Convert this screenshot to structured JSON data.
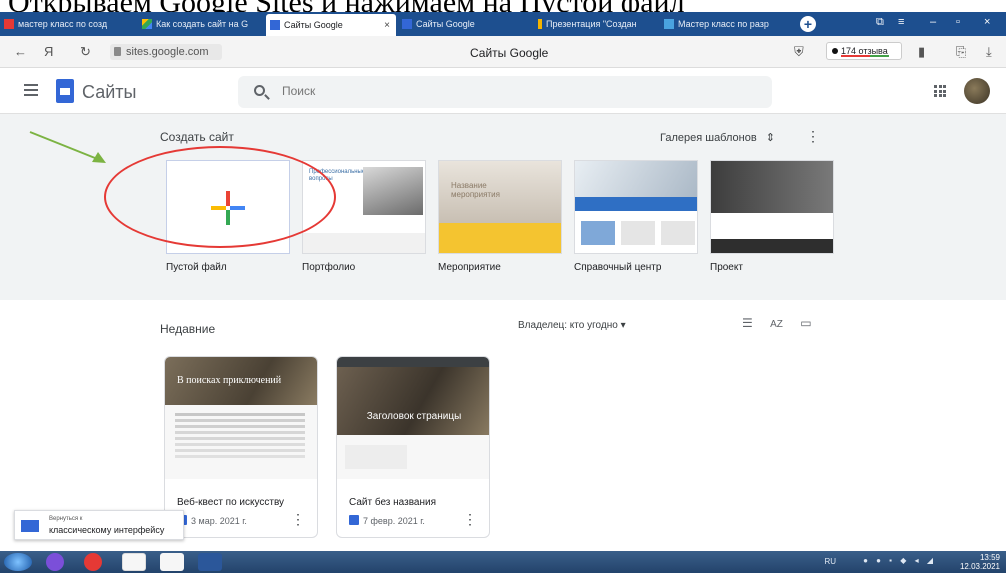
{
  "caption": "Открываем Google Sites и нажимаем на Пустой файл",
  "browser": {
    "tabs": [
      {
        "label": "мастер класс по созд",
        "icon": "yandex-icon",
        "active": false
      },
      {
        "label": "Как создать сайт на G",
        "icon": "drive-icon",
        "active": false
      },
      {
        "label": "Сайты Google",
        "icon": "sites-icon",
        "active": true
      },
      {
        "label": "Сайты Google",
        "icon": "sites-icon",
        "active": false
      },
      {
        "label": "Презентация \"Создан",
        "icon": "slides-icon",
        "active": false
      },
      {
        "label": "Мастер класс по разр",
        "icon": "blog-icon",
        "active": false
      }
    ],
    "tab_close": "×",
    "new_tab": "+",
    "url": "sites.google.com",
    "page_title": "Сайты Google",
    "reviews": "174 отзыва",
    "nav_back": "←",
    "nav_yandex": "Я",
    "nav_reload": "↻"
  },
  "app": {
    "name": "Сайты",
    "search_placeholder": "Поиск"
  },
  "create": {
    "title": "Создать сайт",
    "gallery": "Галерея шаблонов",
    "gallery_arrow": "⇕",
    "more": "⋮",
    "templates": [
      {
        "label": "Пустой файл"
      },
      {
        "label": "Портфолио",
        "thumb_text": "Профессиональные вопросы"
      },
      {
        "label": "Мероприятие",
        "thumb_text": "Название мероприятия"
      },
      {
        "label": "Справочный центр"
      },
      {
        "label": "Проект"
      }
    ]
  },
  "recent": {
    "title": "Недавние",
    "owner_filter": "Владелец: кто угодно ▾",
    "view_list": "☰",
    "view_sort": "AZ",
    "view_folder": "▭",
    "items": [
      {
        "title": "Веб-квест по искусству",
        "date": "3 мар. 2021 г.",
        "thumb_heading": "В поисках приключений"
      },
      {
        "title": "Сайт без названия",
        "date": "7 февр. 2021 г.",
        "thumb_heading": "Заголовок страницы"
      }
    ],
    "menu": "⋮"
  },
  "toast": {
    "line1": "Вернуться к",
    "line2": "классическому интерфейсу"
  },
  "taskbar": {
    "lang": "RU",
    "time": "13:59",
    "date": "12.03.2021"
  },
  "colors": {
    "brand": "#3367d6",
    "highlight_circle": "#e53935",
    "arrow": "#7cb342"
  }
}
